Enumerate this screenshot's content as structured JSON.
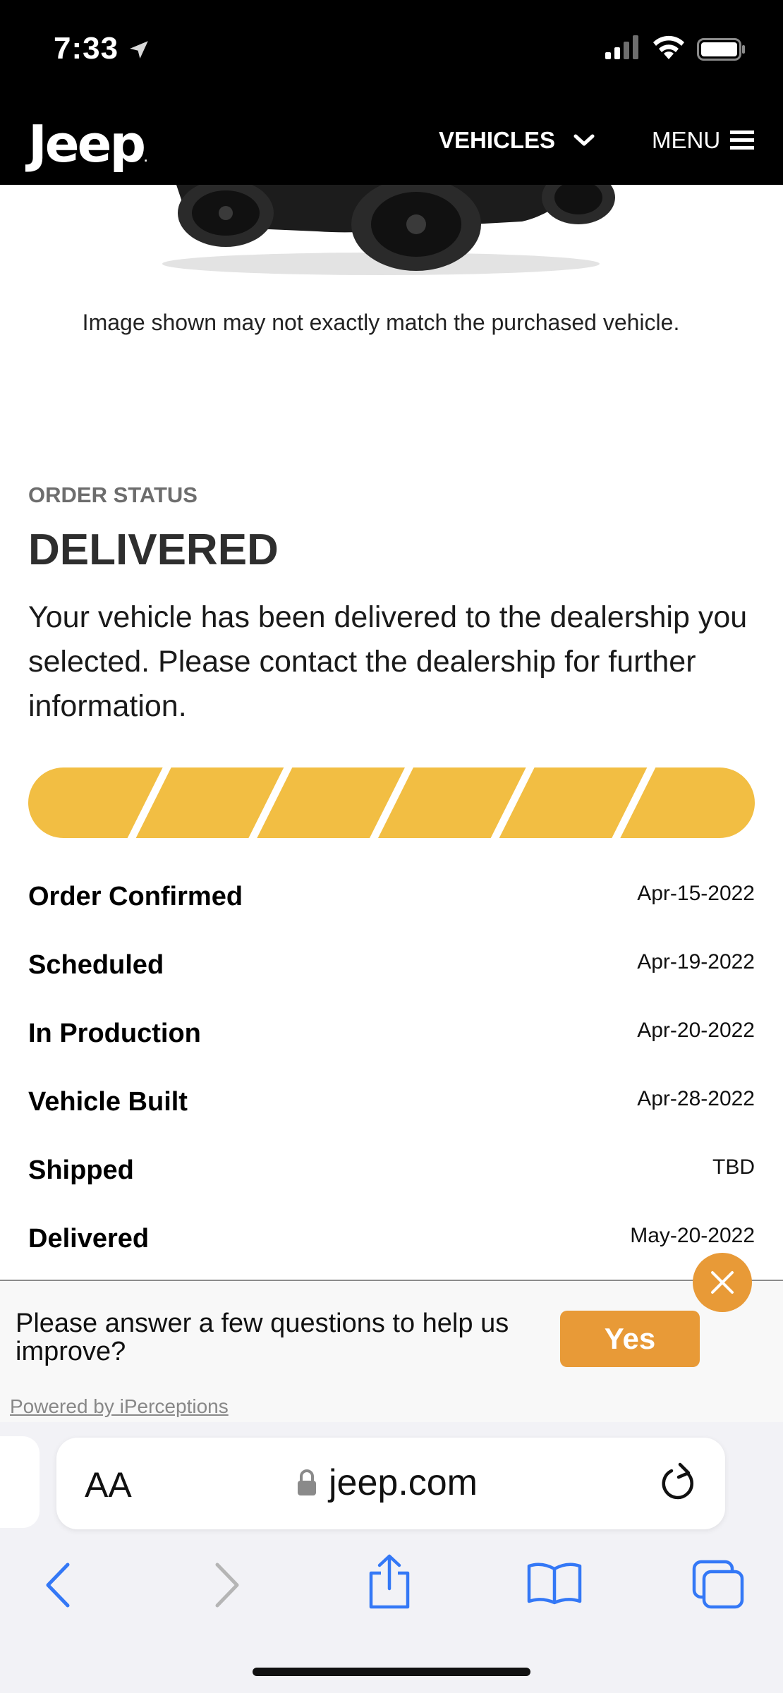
{
  "status_bar": {
    "time": "7:33"
  },
  "header": {
    "logo": "Jeep",
    "vehicles_label": "VEHICLES",
    "menu_label": "MENU"
  },
  "hero": {
    "disclaimer": "Image shown may not exactly match the purchased vehicle."
  },
  "order": {
    "label": "ORDER STATUS",
    "status": "DELIVERED",
    "description": "Your vehicle has been delivered to the dealership you selected. Please contact the dealership for further information.",
    "progress_segments": 6,
    "progress_completed": 6,
    "progress_color": "#f2be43",
    "milestones": [
      {
        "name": "Order Confirmed",
        "date": "Apr-15-2022"
      },
      {
        "name": "Scheduled",
        "date": "Apr-19-2022"
      },
      {
        "name": "In Production",
        "date": "Apr-20-2022"
      },
      {
        "name": "Vehicle Built",
        "date": "Apr-28-2022"
      },
      {
        "name": "Shipped",
        "date": "TBD"
      },
      {
        "name": "Delivered",
        "date": "May-20-2022"
      }
    ]
  },
  "survey": {
    "question": "Please answer a few questions to help us improve?",
    "yes_label": "Yes",
    "powered_by": "Powered by iPerceptions",
    "accent": "#e89a37"
  },
  "browser": {
    "text_size_label": "AA",
    "host": "jeep.com",
    "tint": "#3478f6"
  }
}
